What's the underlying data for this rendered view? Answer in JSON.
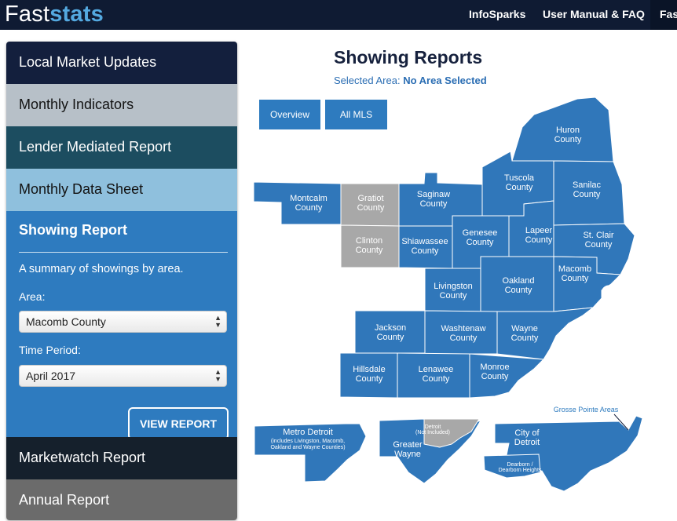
{
  "header": {
    "logo_light": "Fast",
    "logo_bold": "stats",
    "nav": [
      "InfoSparks",
      "User Manual & FAQ",
      "Fas"
    ]
  },
  "sidebar": {
    "items": [
      {
        "label": "Local Market Updates"
      },
      {
        "label": "Monthly Indicators"
      },
      {
        "label": "Lender Mediated Report"
      },
      {
        "label": "Monthly Data Sheet"
      },
      {
        "label": "Showing Report"
      },
      {
        "label": "Marketwatch Report"
      },
      {
        "label": "Annual Report"
      }
    ],
    "active": {
      "summary": "A summary of showings by area.",
      "area_label": "Area:",
      "area_value": "Macomb County",
      "period_label": "Time Period:",
      "period_value": "April 2017",
      "view_button": "VIEW REPORT"
    }
  },
  "main": {
    "title": "Showing Reports",
    "selected_prefix": "Selected Area:",
    "selected_value": "No Area Selected",
    "buttons": [
      "Overview",
      "All MLS"
    ]
  },
  "map": {
    "counties": {
      "huron": [
        "Huron",
        "County"
      ],
      "tuscola": [
        "Tuscola",
        "County"
      ],
      "sanilac": [
        "Sanilac",
        "County"
      ],
      "montcalm": [
        "Montcalm",
        "County"
      ],
      "gratiot": [
        "Gratiot",
        "County"
      ],
      "saginaw": [
        "Saginaw",
        "County"
      ],
      "clinton": [
        "Clinton",
        "County"
      ],
      "shiawassee": [
        "Shiawassee",
        "County"
      ],
      "genesee": [
        "Genesee",
        "County"
      ],
      "lapeer": [
        "Lapeer",
        "County"
      ],
      "stclair": [
        "St. Clair",
        "County"
      ],
      "livingston": [
        "Livingston",
        "County"
      ],
      "oakland": [
        "Oakland",
        "County"
      ],
      "macomb": [
        "Macomb",
        "County"
      ],
      "jackson": [
        "Jackson",
        "County"
      ],
      "washtenaw": [
        "Washtenaw",
        "County"
      ],
      "wayne": [
        "Wayne",
        "County"
      ],
      "hillsdale": [
        "Hillsdale",
        "County"
      ],
      "lenawee": [
        "Lenawee",
        "County"
      ],
      "monroe": [
        "Monroe",
        "County"
      ]
    },
    "metro": {
      "title": "Metro Detroit",
      "note": [
        "(includes Livingston, Macomb,",
        "Oakland and Wayne Counties)"
      ],
      "greater_wayne": [
        "Greater",
        "Wayne"
      ],
      "detroit_inset": [
        "Detroit",
        "(Not Included)"
      ],
      "city_of_detroit": [
        "City of",
        "Detroit"
      ],
      "grosse_pointe": "Grosse Pointe Areas",
      "dearborn": [
        "Dearborn /",
        "Dearborn Heights"
      ]
    },
    "colors": {
      "county": "#3077ba",
      "not_included": "#a8a8a8",
      "accent": "#2e7bbf"
    }
  }
}
